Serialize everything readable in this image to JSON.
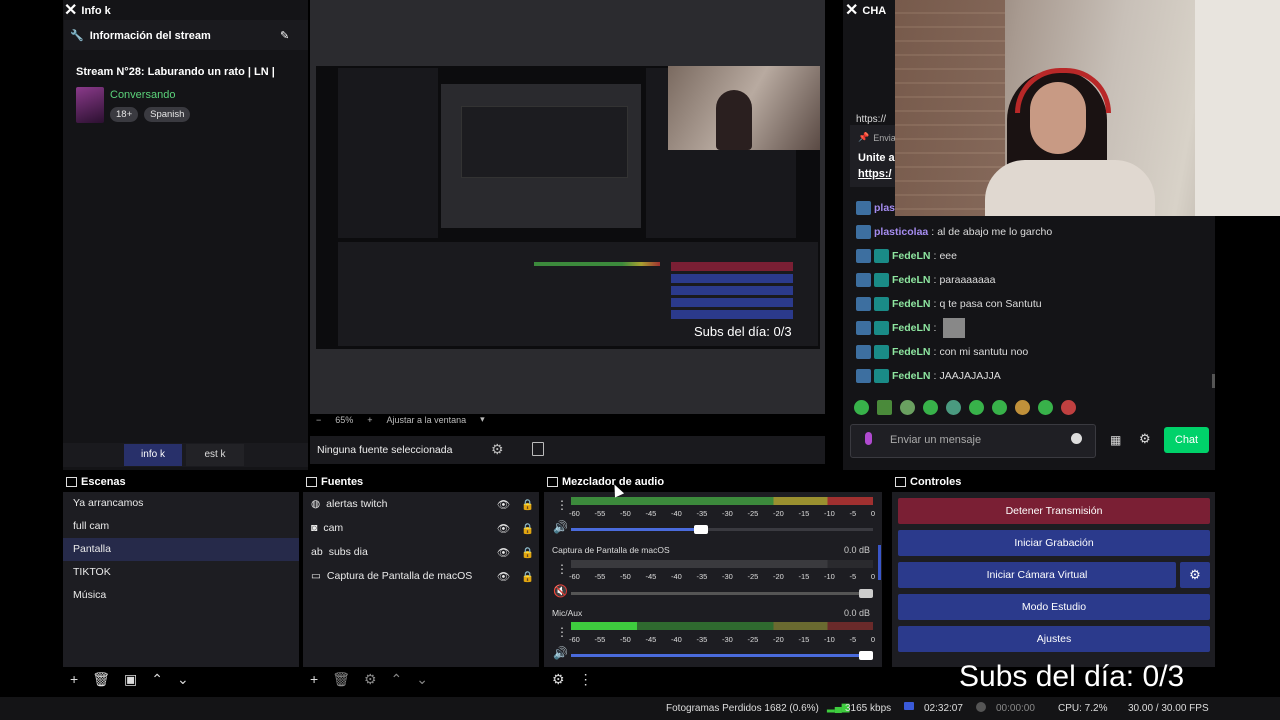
{
  "info_dock": {
    "tab_title": "Info k",
    "header": "Información del stream",
    "stream_title": "Stream N°28: Laburando un rato | LN |",
    "category": "Conversando",
    "tags": [
      "18+",
      "Spanish"
    ],
    "tabs": [
      "info k",
      "est k"
    ]
  },
  "chat_dock": {
    "tab_title": "CHA",
    "link_partial": "https://",
    "pinned_label": "Envia",
    "pinned_text": "Unite a",
    "pinned_link": "https:/",
    "messages": [
      {
        "user": "plasticolaa",
        "text": "al de abajo me lo garcho"
      },
      {
        "user": "FedeLN",
        "text": "eee"
      },
      {
        "user": "FedeLN",
        "text": "paraaaaaaa"
      },
      {
        "user": "FedeLN",
        "text": "q te pasa con Santutu"
      },
      {
        "user": "FedeLN",
        "text": ""
      },
      {
        "user": "FedeLN",
        "text": "con mi santutu noo"
      },
      {
        "user": "FedeLN",
        "text": "JAAJAJAJJA"
      }
    ],
    "partial_user": "plas",
    "input_placeholder": "Enviar un mensaje",
    "chat_button": "Chat"
  },
  "preview": {
    "zoom": "65%",
    "fit_label": "Ajustar a la ventana",
    "no_source": "Ninguna fuente seleccionada",
    "overlay_text": "Subs del día: 0/3"
  },
  "scenes": {
    "title": "Escenas",
    "items": [
      "Ya arrancamos",
      "full cam",
      "Pantalla",
      "TIKTOK",
      "Música"
    ],
    "active_index": 2
  },
  "sources": {
    "title": "Fuentes",
    "items": [
      {
        "name": "alertas twitch",
        "icon": "globe-icon"
      },
      {
        "name": "cam",
        "icon": "camera-icon"
      },
      {
        "name": "subs dia",
        "icon": "text-icon"
      },
      {
        "name": "Captura de Pantalla de macOS",
        "icon": "monitor-icon"
      }
    ]
  },
  "mixer": {
    "title": "Mezclador de audio",
    "ticks": [
      "-60",
      "-55",
      "-50",
      "-45",
      "-40",
      "-35",
      "-30",
      "-25",
      "-20",
      "-15",
      "-10",
      "-5",
      "0"
    ],
    "channels": [
      {
        "name": "",
        "db": "",
        "level": 1.0,
        "volume": 0.43
      },
      {
        "name": "Captura de Pantalla de macOS",
        "db": "0.0 dB",
        "level": 0.0,
        "volume": 1.0
      },
      {
        "name": "Mic/Aux",
        "db": "0.0 dB",
        "level": 0.22,
        "volume": 1.0
      }
    ]
  },
  "controls": {
    "title": "Controles",
    "buttons": [
      "Detener Transmisión",
      "Iniciar Grabación",
      "Iniciar Cámara Virtual",
      "Modo Estudio",
      "Ajustes"
    ],
    "overlay_text": "Subs del día: 0/3"
  },
  "status": {
    "dropped": "Fotogramas Perdidos 1682 (0.6%)",
    "bitrate": "3165 kbps",
    "stream_time": "02:32:07",
    "rec_time": "00:00:00",
    "cpu": "CPU: 7.2%",
    "fps": "30.00 / 30.00 FPS"
  },
  "colors": {
    "accent_green": "#00d26a",
    "stop_red": "#7a1f34",
    "button_blue": "#2b3a8c",
    "scene_active": "#262a4a"
  }
}
